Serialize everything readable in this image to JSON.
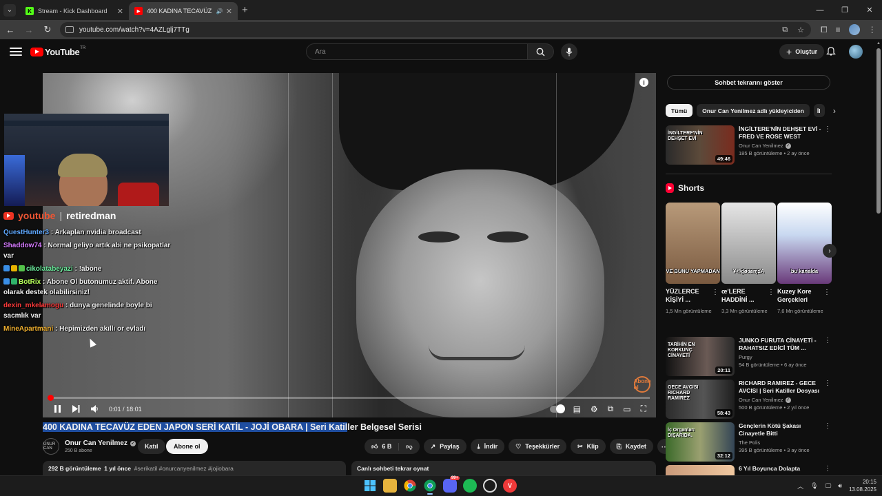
{
  "browser": {
    "tabs": [
      {
        "title": "Stream - Kick Dashboard",
        "favicon": "K",
        "active": false
      },
      {
        "title": "400 KADINA TECAVÜZ EDEN",
        "favicon": "▶",
        "active": true
      }
    ],
    "new_tab": "+",
    "url": "youtube.com/watch?v=4AZLglj7TTg"
  },
  "youtube": {
    "logo_text": "YouTube",
    "country_code": "TR",
    "search_placeholder": "Ara",
    "create_label": "Oluştur"
  },
  "stream_overlay": {
    "platform": "youtube",
    "handle": "retiredman",
    "chat": [
      {
        "user": "QuestHunter3",
        "color": "#5fa8ff",
        "text": "Arkaplan nvidia broadcast",
        "badges": []
      },
      {
        "user": "Shaddow74",
        "color": "#d67bff",
        "text": "Normal geliyo artık abi ne psikopatlar var",
        "badges": []
      },
      {
        "user": "cikolatabeyazi",
        "color": "#6ef0a0",
        "text": "!abone",
        "badges": [
          "#3a8ee6",
          "#e8b300",
          "#53c24a"
        ]
      },
      {
        "user": "BotRix",
        "color": "#b6ff5a",
        "text": "Abone Ol butonumuz aktif. Abone olarak destek olabilirsiniz!",
        "badges": [
          "#3a8ee6",
          "#2fb36a"
        ]
      },
      {
        "user": "dexin_mkelamogu",
        "color": "#ff3b3b",
        "text": "dunya genelinde boyle bi sacmlık var",
        "badges": []
      },
      {
        "user": "MineApartmani",
        "color": "#f0b030",
        "text": "Hepimizden akıllı or evladı",
        "badges": []
      }
    ]
  },
  "player": {
    "time_current": "0:01",
    "time_separator": "/",
    "time_total": "18:01",
    "progress_fraction": 0.001,
    "watermark": "Abone ol"
  },
  "video": {
    "title_selected": "400 KADINA TECAVÜZ EDEN JAPON SERİ KATİL - JOJİ OBARA | Seri Katil",
    "title_rest": "ler Belgesel Serisi",
    "channel_name": "Onur Can Yenilmez",
    "channel_avatar_text": "UNUR CAN",
    "subscribers": "250 B abone",
    "join_label": "Katıl",
    "subscribe_label": "Abone ol",
    "likes": "6 B",
    "share_label": "Paylaş",
    "download_label": "İndir",
    "thanks_label": "Teşekkürler",
    "clip_label": "Klip",
    "save_label": "Kaydet",
    "views": "292 B görüntüleme",
    "age": "1 yıl önce",
    "hashtags": "#serikatil #onurcanyenilmez #jojiobara",
    "chat_replay_bar": "Canlı sohbeti tekrar oynat"
  },
  "sidebar": {
    "chat_replay_button": "Sohbet tekrarını göster",
    "chips": [
      "Tümü",
      "Onur Can Yenilmez adlı yükleyiciden",
      "İl"
    ],
    "videos_top": [
      {
        "title": "İNGİLTERE'NİN DEHŞET EVİ - FRED VE ROSE WEST",
        "channel": "Onur Can Yenilmez",
        "verified": true,
        "stats": "185 B görüntüleme • 2 ay önce",
        "duration": "49:46",
        "thumb_text": "İNGİLTERE'NİN DEHŞET EVİ",
        "thumb_text_color": "#ffffff"
      }
    ],
    "shorts_title": "Shorts",
    "shorts": [
      {
        "title": "YÜZLERCE KİŞİYİ ...",
        "views": "1,5 Mn görüntüleme",
        "thumb_text": "VE BUNU YAPMADAN"
      },
      {
        "title": "œ'LERE HADDİNİ ...",
        "views": "3,3 Mn görüntüleme",
        "thumb_text": "¥@ɠøɞɕɱ≤A"
      },
      {
        "title": "Kuzey Kore Gerçekleri",
        "views": "7,6 Mn görüntüleme",
        "thumb_text": "bu kanalda"
      }
    ],
    "videos_bottom": [
      {
        "title": "JUNKO FURUTA CİNAYETİ - RAHATSIZ EDİCİ TÜM ...",
        "channel": "Purgy",
        "verified": false,
        "stats": "94 B görüntüleme • 6 ay önce",
        "duration": "20:11",
        "thumb_text": "TARİHİN EN KORKUNÇ CİNAYETİ",
        "thumb_text_color": "#ffffff"
      },
      {
        "title": "RICHARD RAMIREZ - GECE AVCISI | Seri Katiller Dosyası ...",
        "channel": "Onur Can Yenilmez",
        "verified": true,
        "stats": "500 B görüntüleme • 2 yıl önce",
        "duration": "58:43",
        "thumb_text": "GECE AVCISI RICHARD RAMIREZ",
        "thumb_text_color": "#ffffff"
      },
      {
        "title": "Gençlerin Kötü Şakası Cinayetle Bitti",
        "channel": "The Polis",
        "verified": false,
        "stats": "395 B görüntüleme • 3 ay önce",
        "duration": "32:12",
        "thumb_text": "İç Organları DIŞARIDA.",
        "thumb_text_color": "#ffffff"
      },
      {
        "title": "6 Yıl Boyunca Dolapta",
        "channel": "",
        "verified": false,
        "stats": "",
        "duration": "",
        "thumb_text": "",
        "thumb_text_color": "#ffffff"
      }
    ]
  },
  "taskbar": {
    "time": "20:15",
    "date": "13.08.2025",
    "discord_badge": "99+"
  },
  "colors": {
    "youtube_red": "#ff0000",
    "page_bg": "#0f0f0f",
    "selection": "#1f4ea0"
  }
}
